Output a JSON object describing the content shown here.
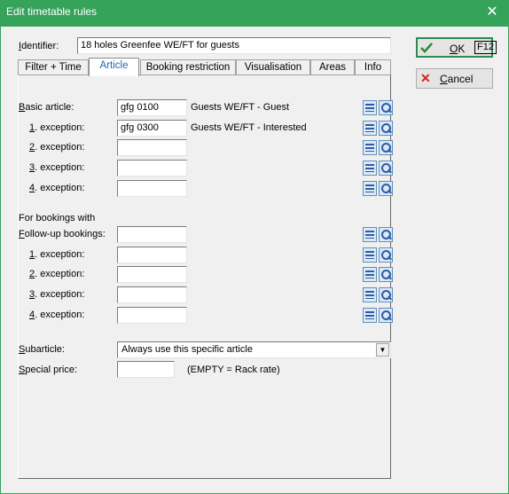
{
  "window": {
    "title": "Edit timetable rules",
    "close_glyph": "✕"
  },
  "identifier": {
    "label_u": "I",
    "label_rest": "dentifier:",
    "value": "18 holes Greenfee WE/FT for guests"
  },
  "tabs": [
    {
      "label": "Filter + Time",
      "active": false
    },
    {
      "label": "Article",
      "active": true
    },
    {
      "label": "Booking restriction",
      "active": false
    },
    {
      "label": "Visualisation",
      "active": false
    },
    {
      "label": "Areas",
      "active": false
    },
    {
      "label": "Info",
      "active": false
    }
  ],
  "basic": {
    "rows": [
      {
        "label_u": "B",
        "label_rest": "asic article:",
        "value": "gfg 0100",
        "desc": "Guests WE/FT - Guest"
      },
      {
        "label_u": "1",
        "label_rest": ". exception:",
        "value": "gfg 0300",
        "desc": "Guests WE/FT - Interested"
      },
      {
        "label_u": "2",
        "label_rest": ". exception:",
        "value": "",
        "desc": ""
      },
      {
        "label_u": "3",
        "label_rest": ". exception:",
        "value": "",
        "desc": ""
      },
      {
        "label_u": "4",
        "label_rest": ". exception:",
        "value": "",
        "desc": ""
      }
    ]
  },
  "followup": {
    "heading": "For bookings with",
    "rows": [
      {
        "label_u": "F",
        "label_rest": "ollow-up bookings:",
        "value": "",
        "desc": ""
      },
      {
        "label_u": "1",
        "label_rest": ". exception:",
        "value": "",
        "desc": ""
      },
      {
        "label_u": "2",
        "label_rest": ". exception:",
        "value": "",
        "desc": ""
      },
      {
        "label_u": "3",
        "label_rest": ". exception:",
        "value": "",
        "desc": ""
      },
      {
        "label_u": "4",
        "label_rest": ". exception:",
        "value": "",
        "desc": ""
      }
    ]
  },
  "subarticle": {
    "label_u": "S",
    "label_rest": "ubarticle:",
    "value": "Always use this specific article"
  },
  "special_price": {
    "label_u": "S",
    "label_rest": "pecial price:",
    "value": "",
    "hint": "(EMPTY = Rack rate)"
  },
  "buttons": {
    "ok": {
      "label_u": "O",
      "label_rest": "K",
      "shortcut": "F12",
      "icon": "check-icon"
    },
    "cancel": {
      "label_u": "C",
      "label_rest": "ancel",
      "icon": "x-icon"
    }
  },
  "colors": {
    "titlebar": "#36a35a",
    "active_tab_text": "#1e66b8",
    "ok_border": "#2d8a55",
    "cancel_x": "#d42020",
    "check": "#2a8a3a"
  }
}
